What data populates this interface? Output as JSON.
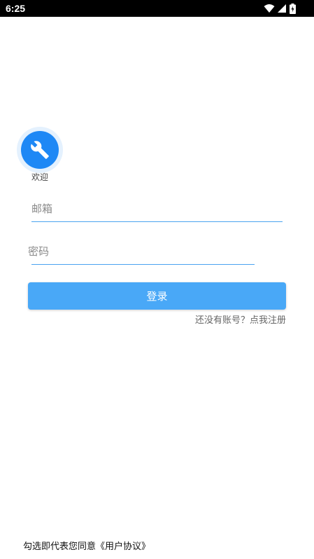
{
  "status_bar": {
    "time": "6:25",
    "icons": [
      "wifi-icon",
      "cellular-signal-icon",
      "battery-charging-icon"
    ]
  },
  "logo": {
    "icon": "wrench-icon",
    "color": "#1e88f5",
    "ring_color": "#e4f1fe"
  },
  "welcome": "欢迎",
  "form": {
    "email_placeholder": "邮箱",
    "email_value": "",
    "password_placeholder": "密码",
    "password_value": "",
    "login_label": "登录",
    "login_color": "#49a8f7",
    "register_link": "还没有账号？点我注册"
  },
  "footer": {
    "agreement": "勾选即代表您同意《用户协议》"
  }
}
